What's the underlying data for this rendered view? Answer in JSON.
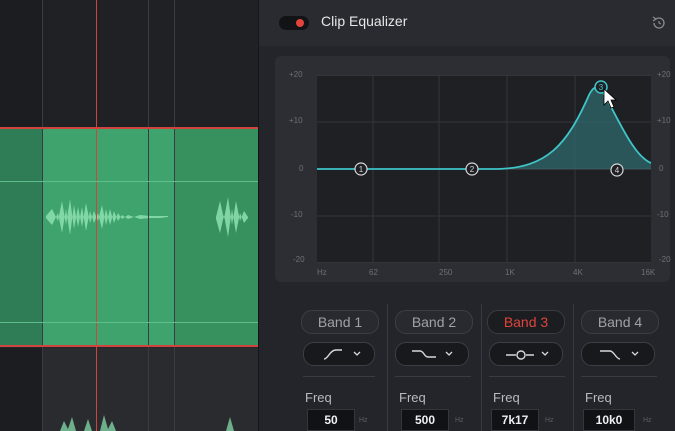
{
  "panel": {
    "title": "Clip Equalizer",
    "enabled": true,
    "accent_color": "#e0443b",
    "curve_color": "#3fc4c8"
  },
  "graph": {
    "y_ticks_left": [
      "+20",
      "+10",
      "0",
      "-10",
      "-20"
    ],
    "y_ticks_right": [
      "+20",
      "+10",
      "0",
      "-10",
      "-20"
    ],
    "x_ticks": [
      "Hz",
      "62",
      "250",
      "1K",
      "4K",
      "16K"
    ],
    "nodes": [
      "1",
      "2",
      "3",
      "4"
    ]
  },
  "bands": [
    {
      "label": "Band 1",
      "active": false,
      "shape_icon": "high-pass-icon",
      "freq_label": "Freq",
      "freq_value": "50",
      "unit": "Hz"
    },
    {
      "label": "Band 2",
      "active": false,
      "shape_icon": "low-shelf-icon",
      "freq_label": "Freq",
      "freq_value": "500",
      "unit": "Hz"
    },
    {
      "label": "Band 3",
      "active": true,
      "shape_icon": "bell-icon",
      "freq_label": "Freq",
      "freq_value": "7k17",
      "unit": "Hz"
    },
    {
      "label": "Band 4",
      "active": false,
      "shape_icon": "low-pass-icon",
      "freq_label": "Freq",
      "freq_value": "10k0",
      "unit": "Hz"
    }
  ]
}
